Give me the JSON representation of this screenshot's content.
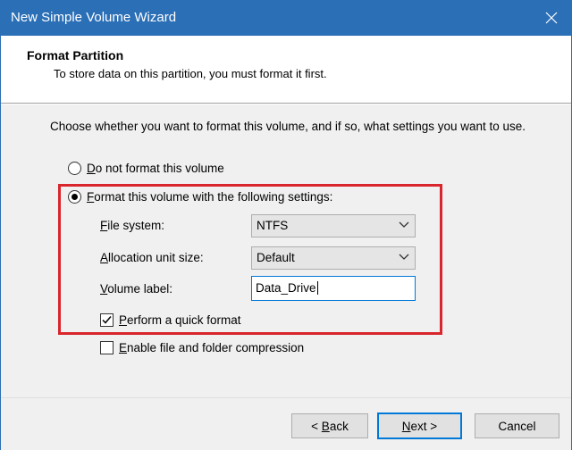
{
  "window": {
    "title": "New Simple Volume Wizard"
  },
  "header": {
    "title": "Format Partition",
    "subtitle": "To store data on this partition, you must format it first."
  },
  "intro": "Choose whether you want to format this volume, and if so, what settings you want to use.",
  "options": {
    "no_format": {
      "label_rest": "o not format this volume",
      "accel": "D",
      "checked": false
    },
    "format": {
      "label_rest": "ormat this volume with the following settings:",
      "accel": "F",
      "checked": true
    }
  },
  "settings": {
    "file_system": {
      "accel": "F",
      "label_rest": "ile system:",
      "value": "NTFS"
    },
    "allocation": {
      "accel": "A",
      "label_rest": "llocation unit size:",
      "value": "Default"
    },
    "volume_label": {
      "accel": "V",
      "label_rest": "olume label:",
      "value": "Data_Drive"
    },
    "quick_format": {
      "accel": "P",
      "label_rest": "erform a quick format",
      "checked": true
    }
  },
  "compression": {
    "accel": "E",
    "label_rest": "nable file and folder compression",
    "checked": false
  },
  "buttons": {
    "back": {
      "prefix": "< ",
      "accel": "B",
      "rest": "ack"
    },
    "next": {
      "accel": "N",
      "rest": "ext >"
    },
    "cancel": "Cancel"
  },
  "colors": {
    "titlebar": "#2b6fb6",
    "highlight": "#d8262c",
    "focus": "#0078d7"
  },
  "icons": {
    "close": "close-icon",
    "dropdown": "chevron-down-icon",
    "check": "checkmark-icon"
  }
}
